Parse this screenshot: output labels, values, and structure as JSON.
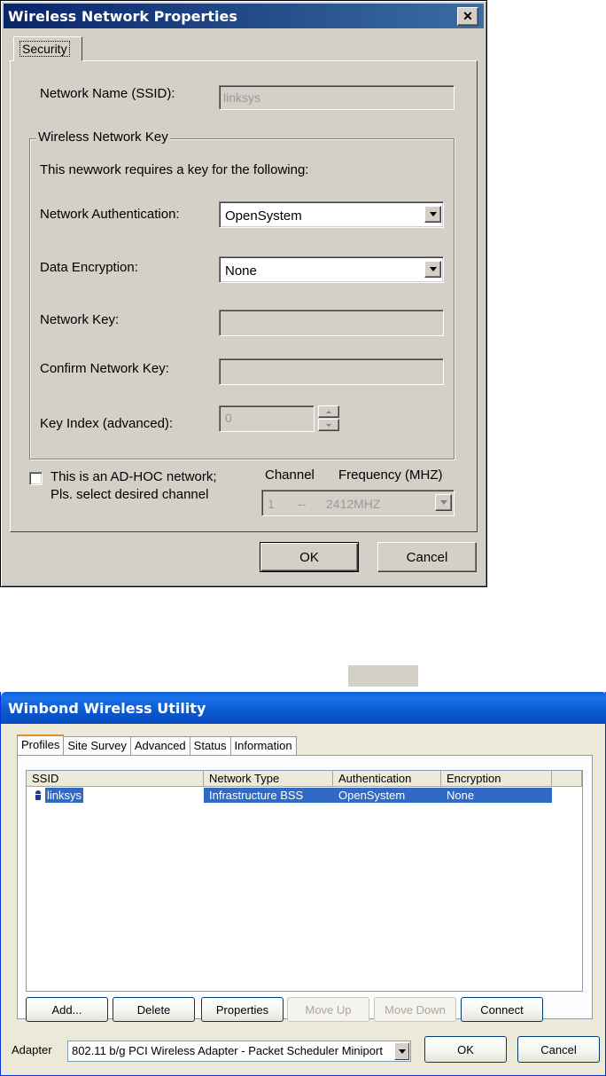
{
  "dialog1": {
    "title": "Wireless Network Properties",
    "close_glyph": "✕",
    "tab": "Security",
    "ssid_label": "Network Name (SSID):",
    "ssid_value": "linksys",
    "group_title": "Wireless Network Key",
    "requires_text": "This newwork requires a key for the following:",
    "auth_label": "Network Authentication:",
    "auth_value": "OpenSystem",
    "enc_label": "Data Encryption:",
    "enc_value": "None",
    "key_label": "Network Key:",
    "key_value": "",
    "confirm_label": "Confirm Network Key:",
    "confirm_value": "",
    "index_label": "Key Index (advanced):",
    "index_value": "0",
    "adhoc_line1": "This is an AD-HOC network;",
    "adhoc_line2": "Pls. select desired channel",
    "adhoc_checked": false,
    "channel_label": "Channel",
    "frequency_label": "Frequency (MHZ)",
    "channel_value": "1",
    "channel_sep": "--",
    "frequency_value": "2412MHZ",
    "ok_label": "OK",
    "cancel_label": "Cancel"
  },
  "dialog2": {
    "title": "Winbond Wireless Utility",
    "tabs": [
      "Profiles",
      "Site Survey",
      "Advanced",
      "Status",
      "Information"
    ],
    "active_tab": "Profiles",
    "columns": [
      "SSID",
      "Network Type",
      "Authentication",
      "Encryption"
    ],
    "rows": [
      {
        "ssid": "linksys",
        "network_type": "Infrastructure BSS",
        "authentication": "OpenSystem",
        "encryption": "None",
        "selected": true
      }
    ],
    "buttons": {
      "add": "Add...",
      "delete": "Delete",
      "properties": "Properties",
      "move_up": "Move Up",
      "move_down": "Move Down",
      "connect": "Connect"
    },
    "adapter_label": "Adapter",
    "adapter_value": "802.11 b/g PCI Wireless Adapter - Packet Scheduler Miniport",
    "ok_label": "OK",
    "cancel_label": "Cancel"
  },
  "colors": {
    "classic_title": "#0a246a",
    "selection": "#316ac5",
    "xp_title": "#0a5fd7"
  }
}
